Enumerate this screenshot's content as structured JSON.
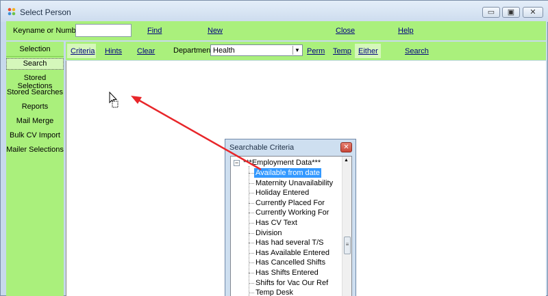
{
  "window": {
    "title": "Select Person",
    "buttons": {
      "minimize": "▭",
      "restore": "▣",
      "close": "✕"
    }
  },
  "topbar": {
    "keyname_label": "Keyname or Number",
    "keyname_value": "",
    "find": "Find",
    "new": "New",
    "close": "Close",
    "help": "Help"
  },
  "sidebar": {
    "heading": "Selection",
    "items": [
      {
        "label": "Search",
        "active": true
      },
      {
        "label": "Stored Selections"
      },
      {
        "label": "Stored Searches"
      },
      {
        "label": "Reports"
      },
      {
        "label": "Mail Merge"
      },
      {
        "label": "Bulk CV Import"
      },
      {
        "label": "Mailer Selections"
      }
    ]
  },
  "criteria_bar": {
    "criteria": "Criteria",
    "hints": "Hints",
    "clear": "Clear",
    "department_label": "Department",
    "department_value": "Health",
    "perm": "Perm",
    "temp": "Temp",
    "either": "Either",
    "search": "Search"
  },
  "popup": {
    "title": "Searchable Criteria",
    "close_icon": "✕",
    "group": "***Employment Data***",
    "items": [
      "Available from date",
      "Maternity Unavailability",
      "Holiday Entered",
      "Currently Placed For",
      "Currently Working For",
      "Has CV Text",
      "Division",
      "Has had several T/S",
      "Has Available Entered",
      "Has Cancelled Shifts",
      "Has Shifts Entered",
      "Shifts for Vac Our Ref",
      "Temp Desk"
    ],
    "selected_index": 0
  },
  "colors": {
    "green_panel": "#aaf07c",
    "selection_blue": "#3399ff",
    "arrow_red": "#e8262a"
  }
}
